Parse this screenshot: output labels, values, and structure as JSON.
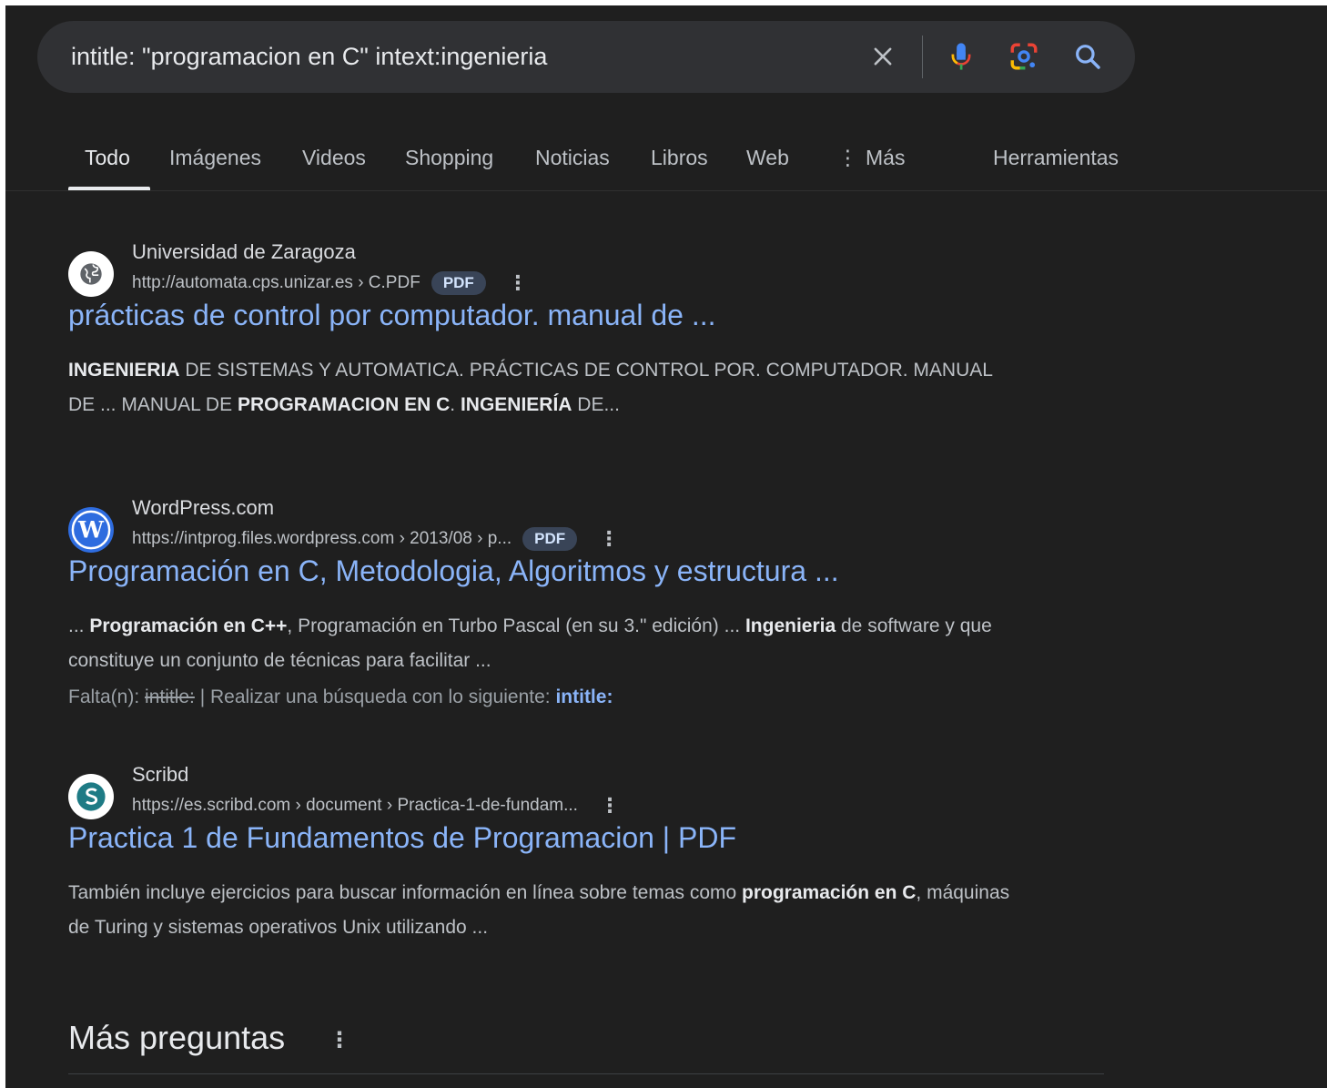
{
  "search": {
    "query": "intitle: \"programacion en C\" intext:ingenieria"
  },
  "tabs": [
    {
      "label": "Todo"
    },
    {
      "label": "Imágenes"
    },
    {
      "label": "Videos"
    },
    {
      "label": "Shopping"
    },
    {
      "label": "Noticias"
    },
    {
      "label": "Libros"
    },
    {
      "label": "Web"
    },
    {
      "label": "Más"
    },
    {
      "label": "Herramientas"
    }
  ],
  "results": [
    {
      "site": "Universidad de Zaragoza",
      "url": "http://automata.cps.unizar.es › C.PDF",
      "badge": "PDF",
      "title": "prácticas de control por computador. manual de ...",
      "snippet": {
        "p1": "INGENIERIA",
        "p2": " DE SISTEMAS Y AUTOMATICA. PRÁCTICAS DE CONTROL POR. COMPUTADOR. MANUAL DE ... MANUAL DE ",
        "p3": "PROGRAMACION EN C",
        "p4": ". ",
        "p5": "INGENIERÍA",
        "p6": " DE..."
      }
    },
    {
      "site": "WordPress.com",
      "url": "https://intprog.files.wordpress.com › 2013/08 › p...",
      "badge": "PDF",
      "title": "Programación en C, Metodologia, Algoritmos y estructura ...",
      "snippet": {
        "p1": "... ",
        "p2": "Programación en C++",
        "p3": ", Programación en Turbo Pascal (en su 3.\" edición) ... ",
        "p4": "Ingenieria",
        "p5": " de software y que constituye un conjunto de técnicas para facilitar ..."
      },
      "missing": {
        "prefix": "Falta(n): ",
        "struck": "intitle:",
        "middle": " | Realizar una búsqueda con lo siguiente: ",
        "link": "intitle:"
      }
    },
    {
      "site": "Scribd",
      "url": "https://es.scribd.com › document › Practica-1-de-fundam...",
      "title": "Practica 1 de Fundamentos de Programacion | PDF",
      "snippet": {
        "p1": "También incluye ejercicios para buscar información en línea sobre temas como ",
        "p2": "programación en C",
        "p3": ", máquinas de Turing y sistemas operativos Unix utilizando ..."
      }
    }
  ],
  "more_questions": {
    "title": "Más preguntas"
  },
  "icons": {
    "clear": "close-icon",
    "mic": "microphone-icon",
    "lens": "google-lens-icon",
    "search": "search-icon"
  },
  "colors": {
    "background": "#1f1f1f",
    "link": "#8ab4f8",
    "text": "#bdc1c6",
    "badge_bg": "#394457"
  }
}
